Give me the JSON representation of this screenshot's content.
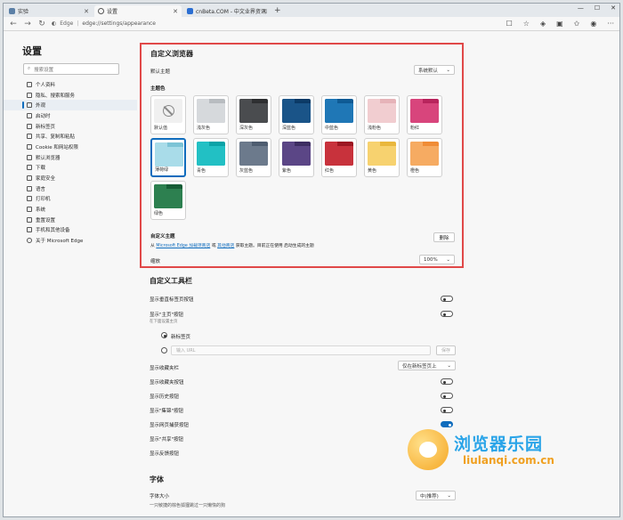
{
  "tabs": [
    {
      "label": "实验",
      "active": false
    },
    {
      "label": "设置",
      "active": true
    },
    {
      "label": "cnBeta.COM - 中文业界资讯站",
      "active": false
    }
  ],
  "address": {
    "brand": "Edge",
    "url": "edge://settings/appearance"
  },
  "sidebar": {
    "title": "设置",
    "search_placeholder": "搜索设置",
    "items": [
      {
        "label": "个人资料"
      },
      {
        "label": "隐私、搜索和服务"
      },
      {
        "label": "外观",
        "selected": true
      },
      {
        "label": "启动时"
      },
      {
        "label": "新标签页"
      },
      {
        "label": "共享、复制和粘贴"
      },
      {
        "label": "Cookie 和网站权限"
      },
      {
        "label": "默认浏览器"
      },
      {
        "label": "下载"
      },
      {
        "label": "家庭安全"
      },
      {
        "label": "语言"
      },
      {
        "label": "打印机"
      },
      {
        "label": "系统"
      },
      {
        "label": "重置设置"
      },
      {
        "label": "手机和其他设备"
      },
      {
        "label": "关于 Microsoft Edge"
      }
    ]
  },
  "customize_browser": {
    "title": "自定义浏览器",
    "default_theme_label": "默认主题",
    "default_theme_value": "系统默认",
    "theme_color_label": "主题色",
    "themes": [
      {
        "name": "默认值",
        "top": "#f0f0f0",
        "body": "#f0f0f0",
        "is_default": true
      },
      {
        "name": "浅灰色",
        "top": "#b8bcc0",
        "body": "#d6d9dc"
      },
      {
        "name": "深灰色",
        "top": "#2e2f31",
        "body": "#4a4c4f"
      },
      {
        "name": "深蓝色",
        "top": "#0b3a66",
        "body": "#1a5488"
      },
      {
        "name": "中蓝色",
        "top": "#0e5a94",
        "body": "#1f77b6"
      },
      {
        "name": "浅粉色",
        "top": "#e6b3b8",
        "body": "#f1cdd0"
      },
      {
        "name": "粉红",
        "top": "#b8245c",
        "body": "#d8457c"
      },
      {
        "name": "薄荷绿",
        "top": "#7cc4d6",
        "body": "#a9dce9",
        "selected": true
      },
      {
        "name": "青色",
        "top": "#0aa3a7",
        "body": "#22c0c4"
      },
      {
        "name": "灰蓝色",
        "top": "#4e5d70",
        "body": "#6c7a8c"
      },
      {
        "name": "紫色",
        "top": "#3d2d62",
        "body": "#5b4686"
      },
      {
        "name": "红色",
        "top": "#9c1722",
        "body": "#c8323c"
      },
      {
        "name": "黄色",
        "top": "#e9b73d",
        "body": "#f7d26f"
      },
      {
        "name": "橙色",
        "top": "#f08c36",
        "body": "#f6ab62"
      },
      {
        "name": "绿色",
        "top": "#175d36",
        "body": "#2d8050"
      }
    ],
    "custom_theme_label": "自定义主题",
    "custom_theme_desc_pre": "从",
    "custom_theme_link1": "Microsoft Edge 加载项商店",
    "custom_theme_mid": "或",
    "custom_theme_link2": "其他商店",
    "custom_theme_desc_post": "获取主题。目前正在使用 启动生成的主题",
    "delete_button": "删除",
    "zoom_label": "缩放",
    "zoom_value": "100%"
  },
  "toolbar_section": {
    "title": "自定义工具栏",
    "show_vertical_tabs": "显示垂直标签页按钮",
    "show_home": "显示\"主页\"按钮",
    "show_home_sub": "在下面设置主页",
    "radio_newtab": "新标签页",
    "url_placeholder": "输入 URL",
    "save_button": "保存",
    "show_favorites_bar": "显示收藏夹栏",
    "favorites_bar_value": "仅在新标签页上",
    "show_favorites_button": "显示收藏夹按钮",
    "show_history_button": "显示历史按钮",
    "show_collections_button": "显示\"集锦\"按钮",
    "show_web_capture_button": "显示网页捕获按钮",
    "show_share_button": "显示\"共享\"按钮",
    "show_feedback_button": "显示反馈按钮"
  },
  "fonts_section": {
    "title": "字体",
    "font_size_label": "字体大小",
    "font_size_sample": "一只敏捷的棕色狐狸跳过一只懒惰的狗",
    "font_size_value": "中(推荐)"
  },
  "watermark": {
    "cn": "浏览器乐园",
    "en": "liulanqi.com.cn"
  }
}
